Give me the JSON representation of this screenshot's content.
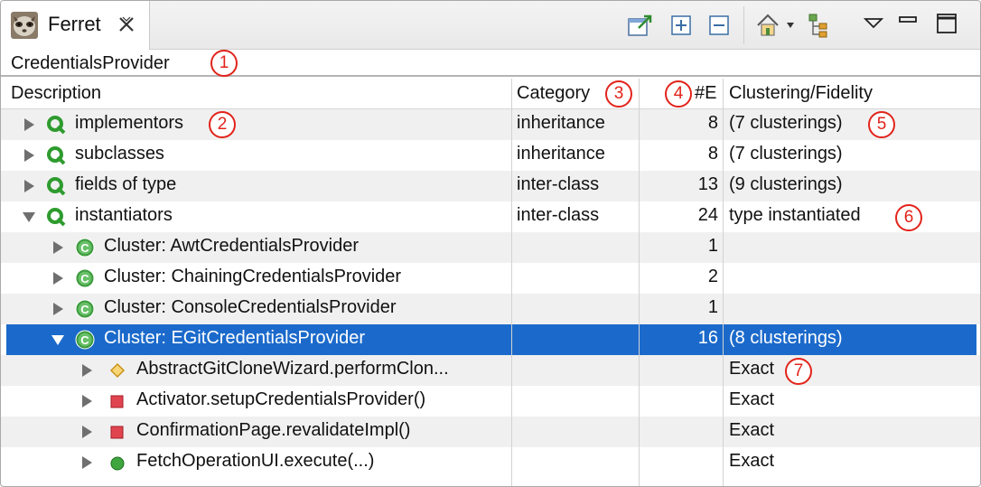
{
  "tab": {
    "title": "Ferret"
  },
  "query": {
    "title": "CredentialsProvider"
  },
  "columns": {
    "description": "Description",
    "category": "Category",
    "count": "#E",
    "clustering": "Clustering/Fidelity"
  },
  "markers": [
    "1",
    "2",
    "3",
    "4",
    "5",
    "6",
    "7"
  ],
  "rows": [
    {
      "label": "implementors",
      "category": "inheritance",
      "count": "8",
      "clustering": "(7 clusterings)",
      "icon": "query-icon",
      "expanded": false
    },
    {
      "label": "subclasses",
      "category": "inheritance",
      "count": "8",
      "clustering": "(7 clusterings)",
      "icon": "query-icon",
      "expanded": false
    },
    {
      "label": "fields of type",
      "category": "inter-class",
      "count": "13",
      "clustering": "(9 clusterings)",
      "icon": "query-icon",
      "expanded": false
    },
    {
      "label": "instantiators",
      "category": "inter-class",
      "count": "24",
      "clustering": "type instantiated",
      "icon": "query-icon",
      "expanded": true
    },
    {
      "label": "Cluster: AwtCredentialsProvider",
      "category": "",
      "count": "1",
      "clustering": "",
      "icon": "cluster-icon",
      "expanded": false
    },
    {
      "label": "Cluster: ChainingCredentialsProvider",
      "category": "",
      "count": "2",
      "clustering": "",
      "icon": "cluster-icon",
      "expanded": false
    },
    {
      "label": "Cluster: ConsoleCredentialsProvider",
      "category": "",
      "count": "1",
      "clustering": "",
      "icon": "cluster-icon",
      "expanded": false
    },
    {
      "label": "Cluster: EGitCredentialsProvider",
      "category": "",
      "count": "16",
      "clustering": "(8 clusterings)",
      "icon": "cluster-icon",
      "expanded": true,
      "selected": true
    },
    {
      "label": "AbstractGitCloneWizard.performClon...",
      "category": "",
      "count": "",
      "clustering": "Exact",
      "icon": "protected-method-icon",
      "expanded": false
    },
    {
      "label": "Activator.setupCredentialsProvider()",
      "category": "",
      "count": "",
      "clustering": "Exact",
      "icon": "private-method-icon",
      "expanded": false
    },
    {
      "label": "ConfirmationPage.revalidateImpl()",
      "category": "",
      "count": "",
      "clustering": "Exact",
      "icon": "private-method-icon",
      "expanded": false
    },
    {
      "label": "FetchOperationUI.execute(...)",
      "category": "",
      "count": "",
      "clustering": "Exact",
      "icon": "public-method-icon",
      "expanded": false
    }
  ],
  "colors": {
    "selection": "#1b6acb",
    "marker": "#e2231a",
    "query_green": "#2e9b2e"
  }
}
